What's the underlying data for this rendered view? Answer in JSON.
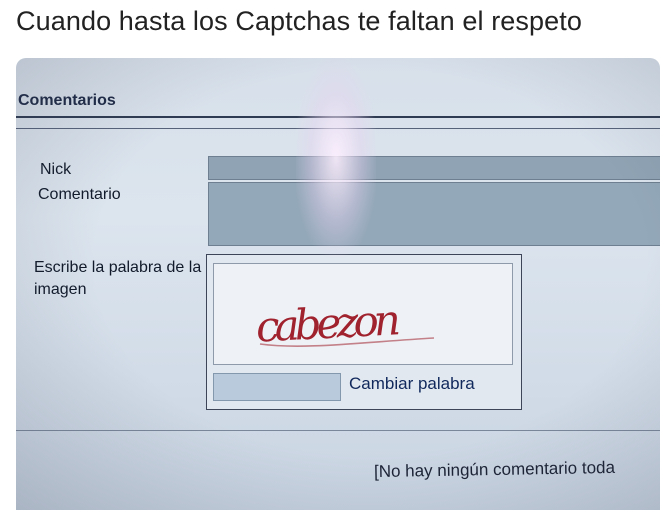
{
  "caption": "Cuando hasta los Captchas te faltan el respeto",
  "form": {
    "section_title": "Comentarios",
    "nick_label": "Nick",
    "comment_label": "Comentario",
    "captcha_label": "Escribe la palabra de la imagen",
    "captcha_word": "cabezon",
    "change_word_label": "Cambiar palabra",
    "empty_message": "[No hay ningún comentario toda"
  },
  "colors": {
    "captcha_ink": "#a0222e",
    "field_fill": "#8fa3b4",
    "link_text": "#10285c"
  }
}
